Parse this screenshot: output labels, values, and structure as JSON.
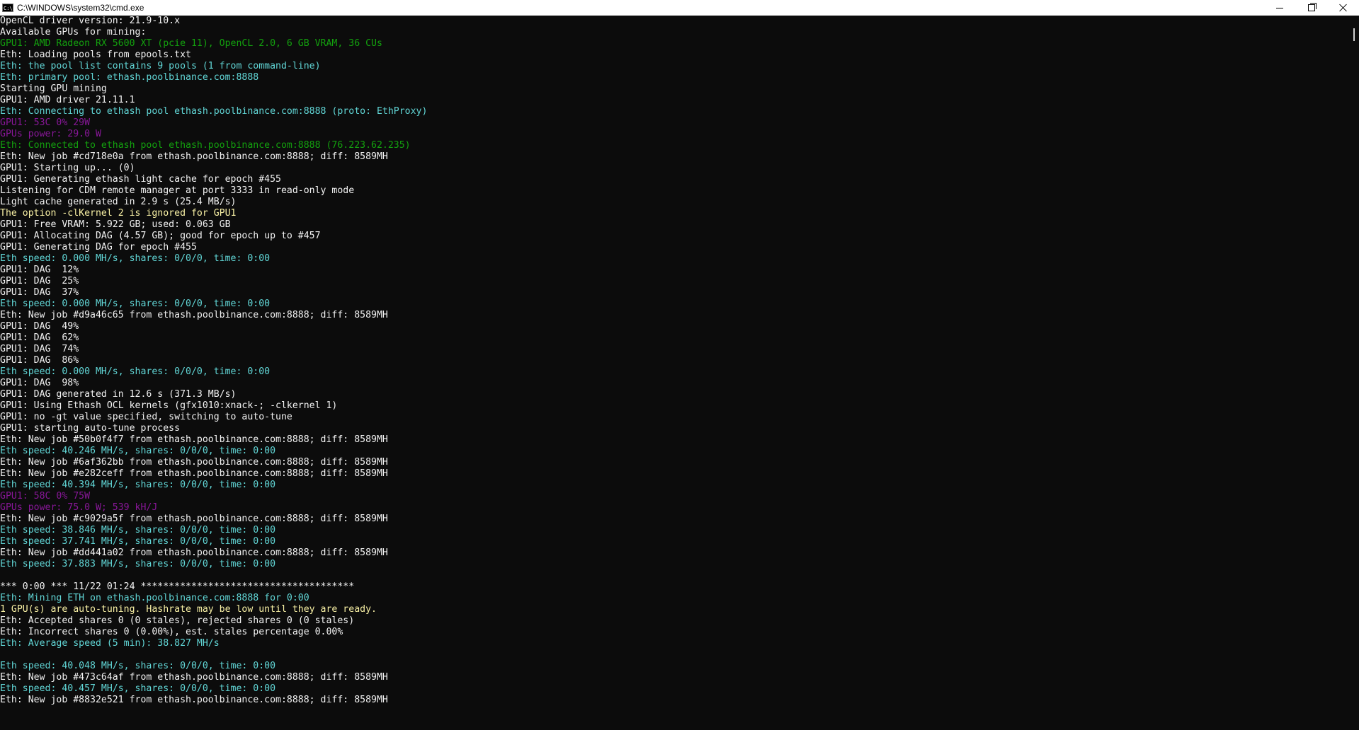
{
  "window": {
    "title": "C:\\WINDOWS\\system32\\cmd.exe",
    "icon": "cmd-icon",
    "controls": [
      "minimize-icon",
      "maximize-icon",
      "close-icon"
    ]
  },
  "colors": {
    "default": "#cccccc",
    "white": "#f2f2f2",
    "green": "#13a10e",
    "cyan": "#3a96dd",
    "teal": "#61d6d6",
    "magenta": "#881798",
    "yellow": "#f9f1a5"
  },
  "console": {
    "lines": [
      {
        "text": "OpenCL driver version: 21.9-10.x",
        "color": "white"
      },
      {
        "text": "Available GPUs for mining:",
        "color": "white"
      },
      {
        "text": "GPU1: AMD Radeon RX 5600 XT (pcie 11), OpenCL 2.0, 6 GB VRAM, 36 CUs",
        "color": "green"
      },
      {
        "text": "Eth: Loading pools from epools.txt",
        "color": "white"
      },
      {
        "text": "Eth: the pool list contains 9 pools (1 from command-line)",
        "color": "teal"
      },
      {
        "text": "Eth: primary pool: ethash.poolbinance.com:8888",
        "color": "teal"
      },
      {
        "text": "Starting GPU mining",
        "color": "white"
      },
      {
        "text": "GPU1: AMD driver 21.11.1",
        "color": "white"
      },
      {
        "text": "Eth: Connecting to ethash pool ethash.poolbinance.com:8888 (proto: EthProxy)",
        "color": "teal"
      },
      {
        "text": "GPU1: 53C 0% 29W",
        "color": "magenta"
      },
      {
        "text": "GPUs power: 29.0 W",
        "color": "magenta"
      },
      {
        "text": "Eth: Connected to ethash pool ethash.poolbinance.com:8888 (76.223.62.235)",
        "color": "green"
      },
      {
        "text": "Eth: New job #cd718e0a from ethash.poolbinance.com:8888; diff: 8589MH",
        "color": "white"
      },
      {
        "text": "GPU1: Starting up... (0)",
        "color": "white"
      },
      {
        "text": "GPU1: Generating ethash light cache for epoch #455",
        "color": "white"
      },
      {
        "text": "Listening for CDM remote manager at port 3333 in read-only mode",
        "color": "white"
      },
      {
        "text": "Light cache generated in 2.9 s (25.4 MB/s)",
        "color": "white"
      },
      {
        "text": "The option -clKernel 2 is ignored for GPU1",
        "color": "yellow"
      },
      {
        "text": "GPU1: Free VRAM: 5.922 GB; used: 0.063 GB",
        "color": "white"
      },
      {
        "text": "GPU1: Allocating DAG (4.57 GB); good for epoch up to #457",
        "color": "white"
      },
      {
        "text": "GPU1: Generating DAG for epoch #455",
        "color": "white"
      },
      {
        "text": "Eth speed: 0.000 MH/s, shares: 0/0/0, time: 0:00",
        "color": "teal"
      },
      {
        "text": "GPU1: DAG  12%",
        "color": "white"
      },
      {
        "text": "GPU1: DAG  25%",
        "color": "white"
      },
      {
        "text": "GPU1: DAG  37%",
        "color": "white"
      },
      {
        "text": "Eth speed: 0.000 MH/s, shares: 0/0/0, time: 0:00",
        "color": "teal"
      },
      {
        "text": "Eth: New job #d9a46c65 from ethash.poolbinance.com:8888; diff: 8589MH",
        "color": "white"
      },
      {
        "text": "GPU1: DAG  49%",
        "color": "white"
      },
      {
        "text": "GPU1: DAG  62%",
        "color": "white"
      },
      {
        "text": "GPU1: DAG  74%",
        "color": "white"
      },
      {
        "text": "GPU1: DAG  86%",
        "color": "white"
      },
      {
        "text": "Eth speed: 0.000 MH/s, shares: 0/0/0, time: 0:00",
        "color": "teal"
      },
      {
        "text": "GPU1: DAG  98%",
        "color": "white"
      },
      {
        "text": "GPU1: DAG generated in 12.6 s (371.3 MB/s)",
        "color": "white"
      },
      {
        "text": "GPU1: Using Ethash OCL kernels (gfx1010:xnack-; -clkernel 1)",
        "color": "white"
      },
      {
        "text": "GPU1: no -gt value specified, switching to auto-tune",
        "color": "white"
      },
      {
        "text": "GPU1: starting auto-tune process",
        "color": "white"
      },
      {
        "text": "Eth: New job #50b0f4f7 from ethash.poolbinance.com:8888; diff: 8589MH",
        "color": "white"
      },
      {
        "text": "Eth speed: 40.246 MH/s, shares: 0/0/0, time: 0:00",
        "color": "teal"
      },
      {
        "text": "Eth: New job #6af362bb from ethash.poolbinance.com:8888; diff: 8589MH",
        "color": "white"
      },
      {
        "text": "Eth: New job #e282ceff from ethash.poolbinance.com:8888; diff: 8589MH",
        "color": "white"
      },
      {
        "text": "Eth speed: 40.394 MH/s, shares: 0/0/0, time: 0:00",
        "color": "teal"
      },
      {
        "text": "GPU1: 58C 0% 75W",
        "color": "magenta"
      },
      {
        "text": "GPUs power: 75.0 W; 539 kH/J",
        "color": "magenta"
      },
      {
        "text": "Eth: New job #c9029a5f from ethash.poolbinance.com:8888; diff: 8589MH",
        "color": "white"
      },
      {
        "text": "Eth speed: 38.846 MH/s, shares: 0/0/0, time: 0:00",
        "color": "teal"
      },
      {
        "text": "Eth speed: 37.741 MH/s, shares: 0/0/0, time: 0:00",
        "color": "teal"
      },
      {
        "text": "Eth: New job #dd441a02 from ethash.poolbinance.com:8888; diff: 8589MH",
        "color": "white"
      },
      {
        "text": "Eth speed: 37.883 MH/s, shares: 0/0/0, time: 0:00",
        "color": "teal"
      },
      {
        "text": "",
        "color": "white"
      },
      {
        "text": "*** 0:00 *** 11/22 01:24 **************************************",
        "color": "white"
      },
      {
        "text": "Eth: Mining ETH on ethash.poolbinance.com:8888 for 0:00",
        "color": "teal"
      },
      {
        "text": "1 GPU(s) are auto-tuning. Hashrate may be low until they are ready.",
        "color": "yellow"
      },
      {
        "text": "Eth: Accepted shares 0 (0 stales), rejected shares 0 (0 stales)",
        "color": "white"
      },
      {
        "text": "Eth: Incorrect shares 0 (0.00%), est. stales percentage 0.00%",
        "color": "white"
      },
      {
        "text": "Eth: Average speed (5 min): 38.827 MH/s",
        "color": "teal"
      },
      {
        "text": "",
        "color": "white"
      },
      {
        "text": "Eth speed: 40.048 MH/s, shares: 0/0/0, time: 0:00",
        "color": "teal"
      },
      {
        "text": "Eth: New job #473c64af from ethash.poolbinance.com:8888; diff: 8589MH",
        "color": "white"
      },
      {
        "text": "Eth speed: 40.457 MH/s, shares: 0/0/0, time: 0:00",
        "color": "teal"
      },
      {
        "text": "Eth: New job #8832e521 from ethash.poolbinance.com:8888; diff: 8589MH",
        "color": "white"
      }
    ]
  }
}
